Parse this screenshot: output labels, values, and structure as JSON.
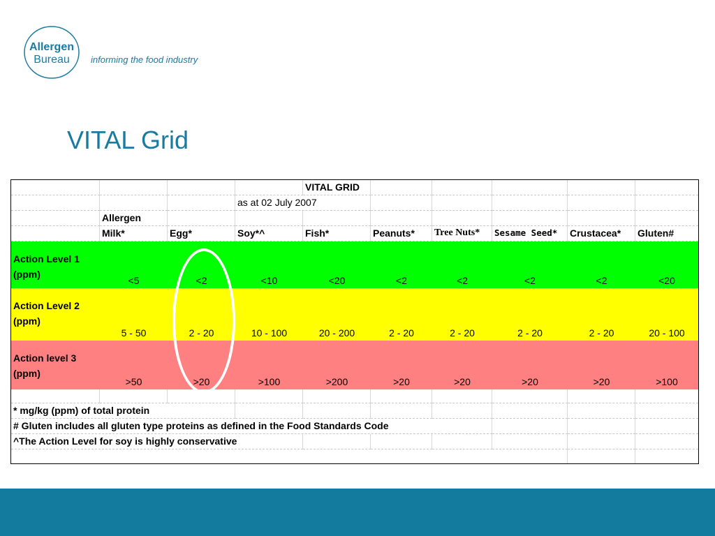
{
  "brand": {
    "logo_line1": "Allergen",
    "logo_line2": "Bureau",
    "tagline": "informing the food industry",
    "color": "#1b7aa0"
  },
  "slide": {
    "title": "VITAL Grid"
  },
  "grid": {
    "title": "VITAL GRID",
    "date": "as at 02 July 2007",
    "allergen_header": "Allergen",
    "columns": [
      "Milk*",
      "Egg*",
      "Soy*^",
      "Fish*",
      "Peanuts*",
      "Tree Nuts*",
      "Sesame Seed*",
      "Crustacea*",
      "Gluten#"
    ],
    "levels": [
      {
        "label_line1": "Action Level 1",
        "label_line2": "(ppm)",
        "color": "#00ff00",
        "values": [
          "<5",
          "<2",
          "<10",
          "<20",
          "<2",
          "<2",
          "<2",
          "<2",
          "<20"
        ]
      },
      {
        "label_line1": "Action Level 2",
        "label_line2": "(ppm)",
        "color": "#ffff00",
        "values": [
          "5 - 50",
          "2 - 20",
          "10 - 100",
          "20 - 200",
          "2 - 20",
          "2 - 20",
          "2 - 20",
          "2 - 20",
          "20 - 100"
        ]
      },
      {
        "label_line1": "Action level 3",
        "label_line2": "(ppm)",
        "color": "#ff8080",
        "values": [
          ">50",
          ">20",
          ">100",
          ">200",
          ">20",
          ">20",
          ">20",
          ">20",
          ">100"
        ]
      }
    ],
    "notes": [
      "* mg/kg (ppm) of total protein",
      "# Gluten includes all gluten type proteins as defined in the Food Standards Code",
      "^The Action Level for soy is highly conservative"
    ]
  },
  "footer": {
    "color": "#137b9e"
  }
}
